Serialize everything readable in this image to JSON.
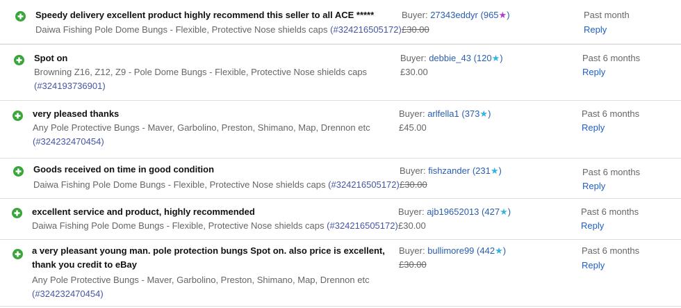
{
  "colors": {
    "positive_icon": "#3aa53a",
    "link": "#2a5db0",
    "reply": "#1f5fc7",
    "item_number": "#4655a8",
    "star_purple": "#b33bd1",
    "star_turquoise": "#35b4e0"
  },
  "feedback": [
    {
      "rating_icon": "positive-plus-icon",
      "comment": "Speedy delivery excellent product highly recommend this seller to all ACE *****",
      "item_title": "Daiwa Fishing Pole Dome Bungs - Flexible, Protective Nose shields caps",
      "item_number": "(#324216505172)",
      "buyer_label": "Buyer:",
      "buyer_name": "27343eddyr",
      "score_open": "(",
      "score": "965",
      "star_icon": "star-purple-icon",
      "star_glyph": "★",
      "score_close": ")",
      "price": "£30.00",
      "price_struck": true,
      "when": "Past month",
      "reply": "Reply"
    },
    {
      "rating_icon": "positive-plus-icon",
      "comment": "Spot on",
      "item_title": "Browning Z16, Z12, Z9 - Pole Dome Bungs - Flexible, Protective Nose shields caps",
      "item_number": "(#324193736901)",
      "buyer_label": "Buyer:",
      "buyer_name": "debbie_43",
      "score_open": "(",
      "score": "120",
      "star_icon": "star-turquoise-icon",
      "star_glyph": "★",
      "score_close": ")",
      "price": "£30.00",
      "price_struck": false,
      "when": "Past 6 months",
      "reply": "Reply"
    },
    {
      "rating_icon": "positive-plus-icon",
      "comment": "very pleased thanks",
      "item_title": "Any Pole Protective Bungs - Maver, Garbolino, Preston, Shimano, Map, Drennon etc",
      "item_number": "(#324232470454)",
      "buyer_label": "Buyer:",
      "buyer_name": "arlfella1",
      "score_open": "(",
      "score": "373",
      "star_icon": "star-turquoise-icon",
      "star_glyph": "★",
      "score_close": ")",
      "price": "£45.00",
      "price_struck": false,
      "when": "Past 6 months",
      "reply": "Reply"
    },
    {
      "rating_icon": "positive-plus-icon",
      "comment": "Goods received on time in good condition",
      "item_title": "Daiwa Fishing Pole Dome Bungs - Flexible, Protective Nose shields caps",
      "item_number": "(#324216505172)",
      "buyer_label": "Buyer:",
      "buyer_name": "fishzander",
      "score_open": "(",
      "score": "231",
      "star_icon": "star-turquoise-icon",
      "star_glyph": "★",
      "score_close": ")",
      "price": "£30.00",
      "price_struck": true,
      "when": "Past 6 months",
      "reply": "Reply"
    },
    {
      "rating_icon": "positive-plus-icon",
      "comment": "excellent service and product, highly recommended",
      "item_title": "Daiwa Fishing Pole Dome Bungs - Flexible, Protective Nose shields caps",
      "item_number": "(#324216505172)",
      "buyer_label": "Buyer:",
      "buyer_name": "ajb19652013",
      "score_open": "(",
      "score": "427",
      "star_icon": "star-turquoise-icon",
      "star_glyph": "★",
      "score_close": ")",
      "price": "£30.00",
      "price_struck": false,
      "when": "Past 6 months",
      "reply": "Reply"
    },
    {
      "rating_icon": "positive-plus-icon",
      "comment": "a very pleasant young man. pole protection bungs Spot on. also price is excellent, thank you credit to eBay",
      "item_title": "Any Pole Protective Bungs - Maver, Garbolino, Preston, Shimano, Map, Drennon etc",
      "item_number": "(#324232470454)",
      "buyer_label": "Buyer:",
      "buyer_name": "bullimore99",
      "score_open": "(",
      "score": "442",
      "star_icon": "star-turquoise-icon",
      "star_glyph": "★",
      "score_close": ")",
      "price": "£30.00",
      "price_struck": true,
      "when": "Past 6 months",
      "reply": "Reply"
    }
  ]
}
